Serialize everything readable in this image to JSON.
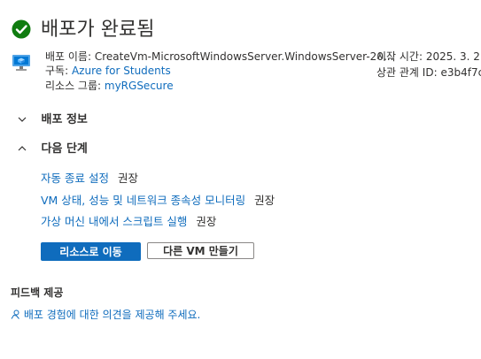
{
  "header": {
    "title": "배포가 완료됨",
    "status_icon": "check-circle-icon",
    "status_color": "#107c10"
  },
  "deployment": {
    "name_label": "배포 이름:",
    "name_value": "CreateVm-MicrosoftWindowsServer.WindowsServer-20...",
    "subscription_label": "구독:",
    "subscription_value": "Azure for Students",
    "resource_group_label": "리소스 그룹:",
    "resource_group_value": "myRGSecure",
    "start_time_label": "시작 시간:",
    "start_time_value": "2025. 3. 2.",
    "correlation_label": "상관 관계 ID:",
    "correlation_value": "e3b4f7c"
  },
  "sections": {
    "details_label": "배포 정보",
    "next_steps_label": "다음 단계"
  },
  "next_steps": [
    {
      "link": "자동 종료 설정",
      "badge": "권장"
    },
    {
      "link": "VM 상태, 성능 및 네트워크 종속성 모니터링",
      "badge": "권장"
    },
    {
      "link": "가상 머신 내에서 스크립트 실행",
      "badge": "권장"
    }
  ],
  "actions": {
    "primary_label": "리소스로 이동",
    "secondary_label": "다른 VM 만들기"
  },
  "feedback": {
    "title": "피드백 제공",
    "link": "배포 경험에 대한 의견을 제공해 주세요."
  },
  "colors": {
    "accent": "#0f6cbd",
    "text": "#323130"
  }
}
